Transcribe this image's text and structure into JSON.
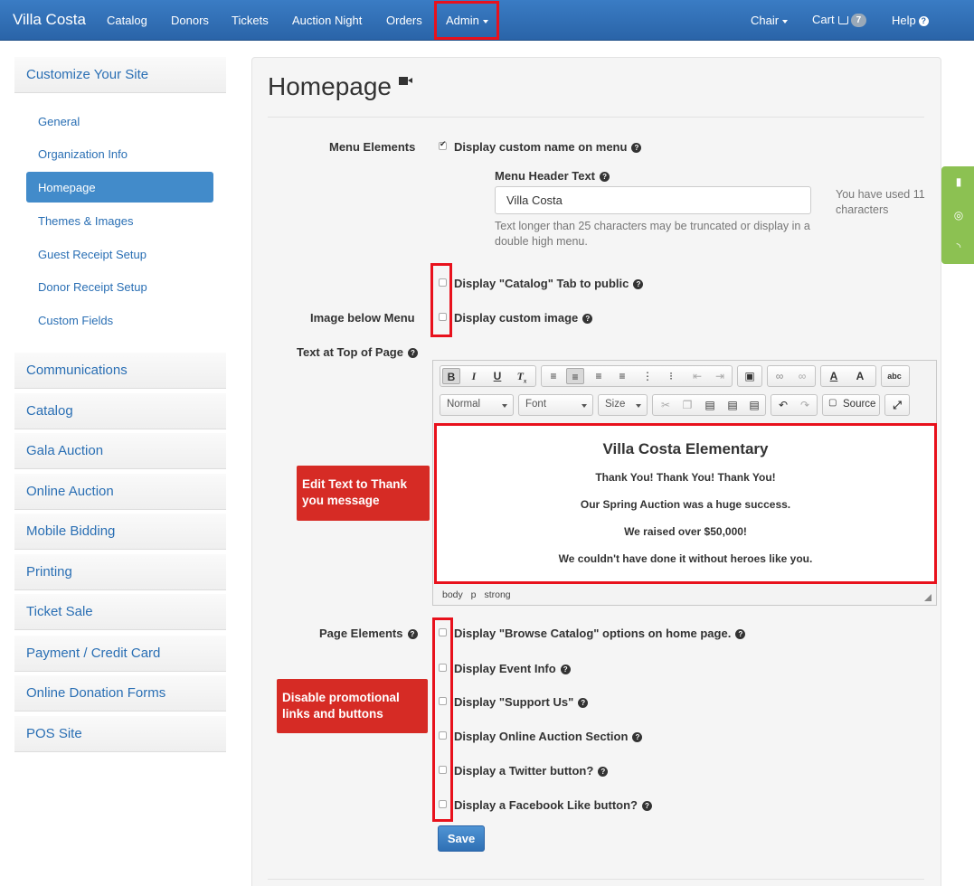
{
  "nav": {
    "brand": "Villa Costa",
    "items": [
      "Catalog",
      "Donors",
      "Tickets",
      "Auction Night",
      "Orders",
      "Admin"
    ],
    "right": {
      "chair": "Chair",
      "cart": "Cart",
      "cart_count": "7",
      "help": "Help"
    }
  },
  "sidebar": {
    "header": "Customize Your Site",
    "links": [
      "General",
      "Organization Info",
      "Homepage",
      "Themes & Images",
      "Guest Receipt Setup",
      "Donor Receipt Setup",
      "Custom Fields"
    ],
    "sections": [
      "Communications",
      "Catalog",
      "Gala Auction",
      "Online Auction",
      "Mobile Bidding",
      "Printing",
      "Ticket Sale",
      "Payment / Credit Card",
      "Online Donation Forms",
      "POS Site"
    ]
  },
  "main": {
    "title": "Homepage",
    "menu_elements_label": "Menu Elements",
    "display_custom_name": "Display custom name on menu",
    "menu_header_text_label": "Menu Header Text",
    "menu_header_value": "Villa Costa",
    "truncate_help": "Text longer than 25 characters may be truncated or display in a double high menu.",
    "used_chars": "You have used 11 characters",
    "display_catalog_tab": "Display \"Catalog\" Tab to public",
    "image_below_menu_label": "Image below Menu",
    "display_custom_image": "Display custom image",
    "text_top_label": "Text at Top of Page",
    "page_elements_label": "Page Elements",
    "page_options": [
      "Display \"Browse Catalog\" options on home page.",
      "Display Event Info",
      "Display \"Support Us\"",
      "Display Online Auction Section",
      "Display a Twitter button?",
      "Display a Facebook Like button?"
    ],
    "save": "Save"
  },
  "editor": {
    "format": "Normal",
    "font": "Font",
    "size": "Size",
    "source": "Source",
    "content_title": "Villa Costa Elementary",
    "content_lines": [
      "Thank You!  Thank You!  Thank You!",
      "Our Spring Auction was a huge success.",
      "We raised over $50,000!",
      "We couldn't have done it without heroes like you."
    ],
    "status_path": "body p strong"
  },
  "callouts": {
    "edit_text": "Edit Text to Thank you message",
    "disable_links": "Disable promotional links and buttons"
  },
  "colors": {
    "nav": "#2d69ad",
    "accent": "#428bca",
    "highlight": "#e8111c",
    "callout": "#d62b25",
    "float": "#8cc152"
  }
}
